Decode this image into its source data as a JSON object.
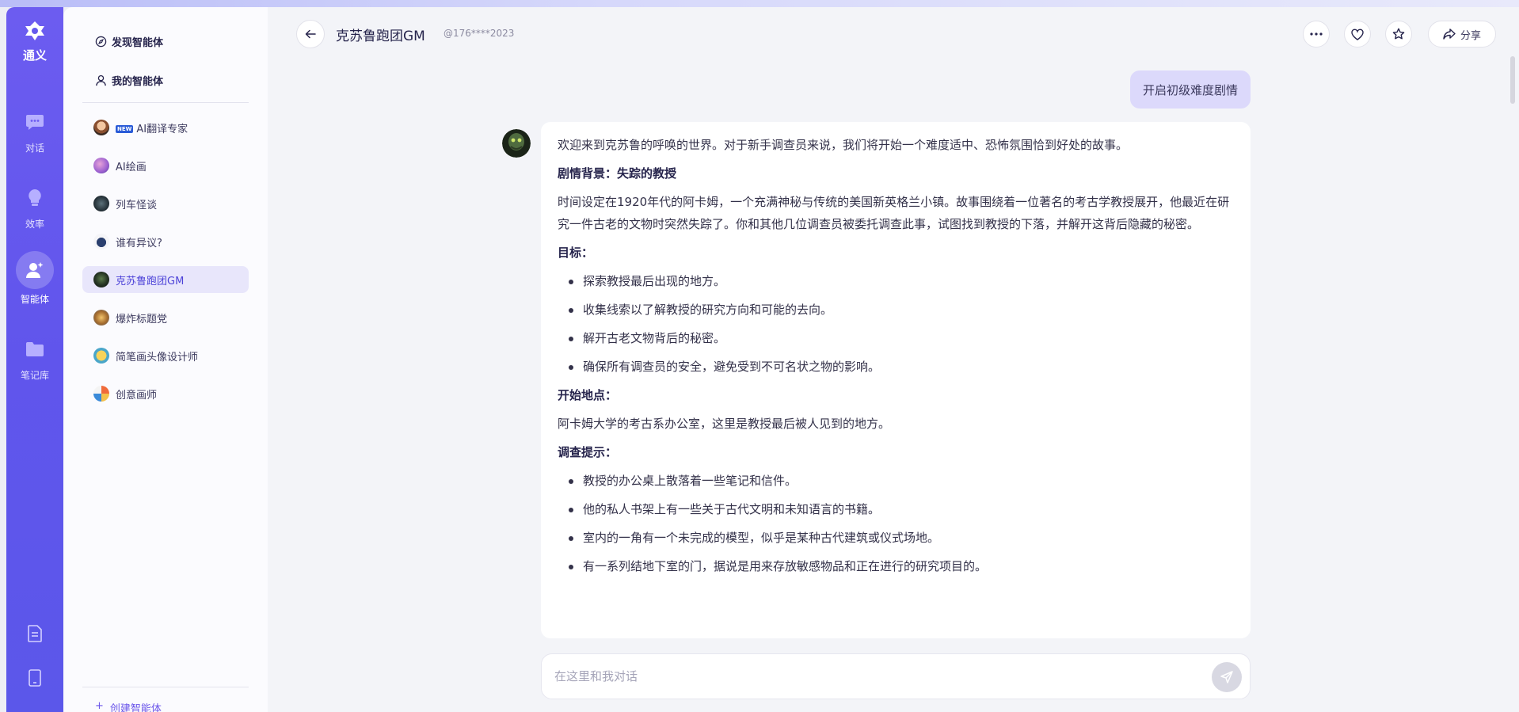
{
  "brand": {
    "name": "通义"
  },
  "rail": {
    "items": [
      {
        "label": "对话",
        "icon": "chat-bubble-icon"
      },
      {
        "label": "效率",
        "icon": "lightbulb-icon"
      },
      {
        "label": "智能体",
        "icon": "agent-icon",
        "active": true
      },
      {
        "label": "笔记库",
        "icon": "folder-icon"
      }
    ],
    "bottom": [
      {
        "icon": "document-icon"
      },
      {
        "icon": "mobile-icon"
      }
    ]
  },
  "sidebar": {
    "discover_label": "发现智能体",
    "mine_label": "我的智能体",
    "agents": [
      {
        "label": "AI翻译专家",
        "badge": "NEW"
      },
      {
        "label": "AI绘画"
      },
      {
        "label": "列车怪谈"
      },
      {
        "label": "谁有异议?"
      },
      {
        "label": "克苏鲁跑团GM",
        "active": true
      },
      {
        "label": "爆炸标题党"
      },
      {
        "label": "简笔画头像设计师"
      },
      {
        "label": "创意画师"
      }
    ],
    "create_label": "创建智能体"
  },
  "header": {
    "title": "克苏鲁跑团GM",
    "handle": "@176****2023",
    "share_label": "分享"
  },
  "chat": {
    "user_message": "开启初级难度剧情",
    "intro": "欢迎来到克苏鲁的呼唤的世界。对于新手调查员来说，我们将开始一个难度适中、恐怖氛围恰到好处的故事。",
    "background_heading": "剧情背景：失踪的教授",
    "background_text": "时间设定在1920年代的阿卡姆，一个充满神秘与传统的美国新英格兰小镇。故事围绕着一位著名的考古学教授展开，他最近在研究一件古老的文物时突然失踪了。你和其他几位调查员被委托调查此事，试图找到教授的下落，并解开这背后隐藏的秘密。",
    "goals_heading": "目标：",
    "goals": [
      "探索教授最后出现的地方。",
      "收集线索以了解教授的研究方向和可能的去向。",
      "解开古老文物背后的秘密。",
      "确保所有调查员的安全，避免受到不可名状之物的影响。"
    ],
    "start_heading": "开始地点：",
    "start_text": "阿卡姆大学的考古系办公室，这里是教授最后被人见到的地方。",
    "hints_heading": "调查提示：",
    "hints": [
      "教授的办公桌上散落着一些笔记和信件。",
      "他的私人书架上有一些关于古代文明和未知语言的书籍。",
      "室内的一角有一个未完成的模型，似乎是某种古代建筑或仪式场地。",
      "有一系列结地下室的门，据说是用来存放敏感物品和正在进行的研究项目的。"
    ]
  },
  "input": {
    "placeholder": "在这里和我对话"
  }
}
